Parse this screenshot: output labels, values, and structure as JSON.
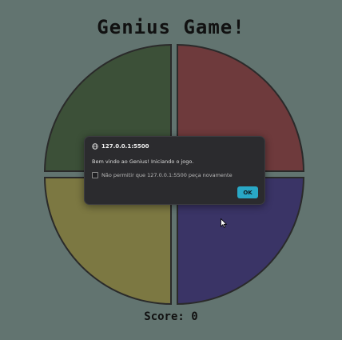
{
  "game": {
    "title": "Genius Game!",
    "score_label": "Score:",
    "score_value": "0"
  },
  "pads": [
    {
      "name": "green",
      "color": "#3c5038"
    },
    {
      "name": "red",
      "color": "#6e3a3c"
    },
    {
      "name": "yellow",
      "color": "#7c7842"
    },
    {
      "name": "blue",
      "color": "#3a3466"
    }
  ],
  "dialog": {
    "origin": "127.0.0.1:5500",
    "message": "Bem vindo ao Genius! Iniciando o jogo.",
    "checkbox_label": "Não permitir que 127.0.0.1:5500 peça novamente",
    "ok_label": "OK"
  },
  "colors": {
    "background": "#627470",
    "dialog_bg": "#2b2b2e",
    "accent": "#29a8c6"
  }
}
